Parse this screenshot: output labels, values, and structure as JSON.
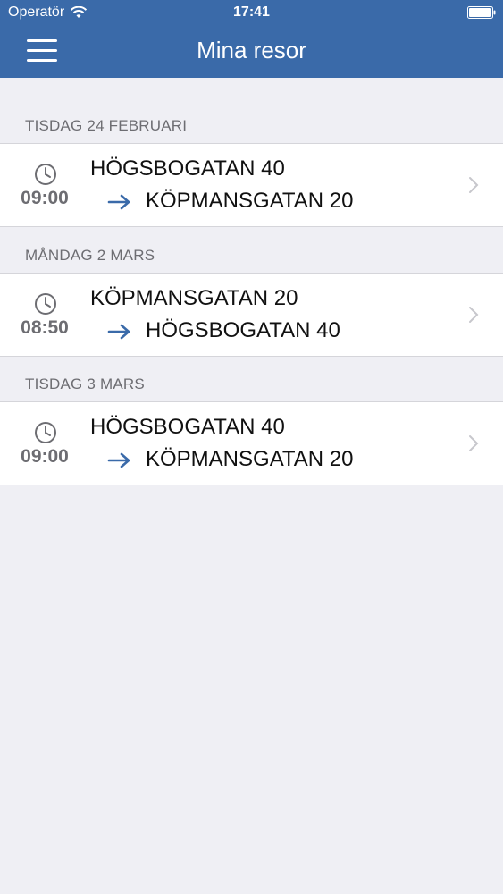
{
  "status_bar": {
    "carrier": "Operatör",
    "time": "17:41"
  },
  "nav": {
    "title": "Mina resor",
    "menu_icon": "hamburger-menu-icon"
  },
  "colors": {
    "nav_background": "#3a6aa9",
    "accent_arrow": "#3a6aa9",
    "screen_background": "#efeff4",
    "secondary_text": "#6d6d72"
  },
  "sections": [
    {
      "header": "TISDAG 24 FEBRUARI",
      "trip": {
        "time": "09:00",
        "from": "HÖGSBOGATAN 40",
        "to": "KÖPMANSGATAN 20"
      }
    },
    {
      "header": "MÅNDAG 2 MARS",
      "trip": {
        "time": "08:50",
        "from": "KÖPMANSGATAN 20",
        "to": "HÖGSBOGATAN 40"
      }
    },
    {
      "header": "TISDAG 3 MARS",
      "trip": {
        "time": "09:00",
        "from": "HÖGSBOGATAN 40",
        "to": "KÖPMANSGATAN 20"
      }
    }
  ],
  "icons": {
    "row_time": "clock-icon",
    "row_direction": "arrow-right-icon",
    "row_disclosure": "chevron-right-icon"
  }
}
